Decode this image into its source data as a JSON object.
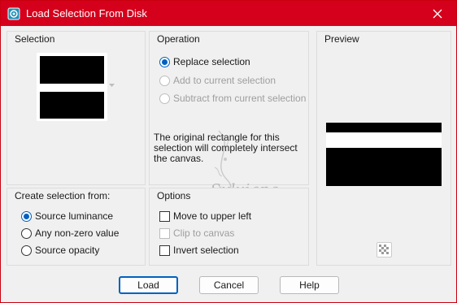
{
  "window": {
    "title": "Load Selection From Disk",
    "accent_color": "#d5001c"
  },
  "selection": {
    "label": "Selection"
  },
  "operation": {
    "label": "Operation",
    "options": [
      {
        "label": "Replace selection",
        "checked": true,
        "enabled": true
      },
      {
        "label": "Add to current selection",
        "checked": false,
        "enabled": false
      },
      {
        "label": "Subtract from current selection",
        "checked": false,
        "enabled": false
      }
    ],
    "info": "The original rectangle for this selection will completely intersect the canvas."
  },
  "preview": {
    "label": "Preview"
  },
  "create_from": {
    "label": "Create selection from:",
    "options": [
      {
        "label": "Source luminance",
        "checked": true
      },
      {
        "label": "Any non-zero value",
        "checked": false
      },
      {
        "label": "Source opacity",
        "checked": false
      }
    ]
  },
  "options": {
    "label": "Options",
    "items": [
      {
        "label": "Move to upper left",
        "checked": false,
        "enabled": true
      },
      {
        "label": "Clip to canvas",
        "checked": false,
        "enabled": false
      },
      {
        "label": "Invert selection",
        "checked": false,
        "enabled": true
      }
    ]
  },
  "buttons": {
    "load": "Load",
    "cancel": "Cancel",
    "help": "Help"
  },
  "watermark": {
    "text": "Sylviane"
  }
}
